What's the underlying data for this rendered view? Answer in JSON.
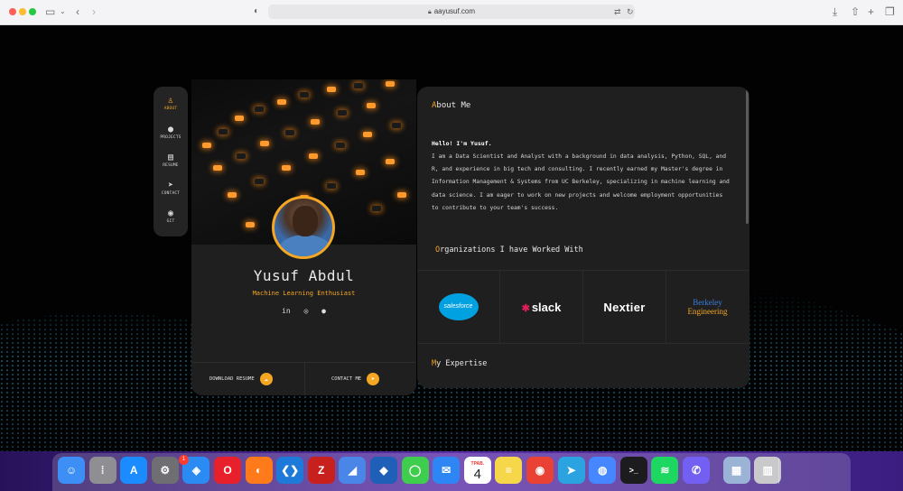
{
  "browser": {
    "url": "aayusuf.com",
    "icons": {
      "sidebar": "sidebar-icon",
      "back": "chevron-left-icon",
      "forward": "chevron-right-icon",
      "shield": "shield-icon",
      "translate": "translate-icon",
      "reload": "reload-icon",
      "download": "download-icon",
      "share": "share-icon",
      "new_tab": "plus-icon",
      "tabs": "tabs-icon"
    }
  },
  "nav": {
    "items": [
      {
        "label": "ABOUT",
        "icon": "user-icon",
        "glyph": "♙",
        "active": true
      },
      {
        "label": "PROJECTS",
        "icon": "lightbulb-icon",
        "glyph": "●",
        "active": false
      },
      {
        "label": "RESUME",
        "icon": "document-icon",
        "glyph": "▤",
        "active": false
      },
      {
        "label": "CONTACT",
        "icon": "paper-plane-icon",
        "glyph": "➤",
        "active": false
      },
      {
        "label": "GIT",
        "icon": "github-icon",
        "glyph": "◉",
        "active": false
      }
    ]
  },
  "profile": {
    "name": "Yusuf Abdul",
    "subtitle": "Machine Learning Enthusiast",
    "socials": [
      {
        "icon": "linkedin-icon",
        "glyph": "in"
      },
      {
        "icon": "instagram-icon",
        "glyph": "◎"
      },
      {
        "icon": "github-icon",
        "glyph": "●"
      }
    ],
    "download_label": "DOWNLOAD RESUME",
    "contact_label": "CONTACT ME"
  },
  "about": {
    "title_first": "A",
    "title_rest": "bout Me",
    "hello": "Hello! I'm Yusuf.",
    "text": "I am a Data Scientist and Analyst with a background in data analysis, Python, SQL, and R, and experience in big tech and consulting. I recently earned my Master's degree in Information Management & Systems from UC Berkeley, specializing in machine learning and data science. I am eager to work on new projects and welcome employment opportunities to contribute to your team's success.",
    "orgs_title_first": "O",
    "orgs_title_rest": "rganizations I have Worked With",
    "orgs": [
      {
        "name": "salesforce",
        "icon": "salesforce-logo-icon"
      },
      {
        "name": "slack",
        "icon": "slack-logo-icon"
      },
      {
        "name": "Nextier",
        "icon": "nextier-logo-icon"
      },
      {
        "name_line1": "Berkeley",
        "name_line2": "Engineering",
        "icon": "berkeley-logo-icon"
      }
    ],
    "expertise_title_first": "M",
    "expertise_title_rest": "y Expertise"
  },
  "dock": {
    "finder_badge": "1",
    "calendar_month": "ТРАВ.",
    "calendar_day": "4",
    "apps": [
      {
        "name": "finder-icon",
        "color": "#3d8ff5",
        "glyph": "☺"
      },
      {
        "name": "launchpad-icon",
        "color": "#8e8e93",
        "glyph": "⁞"
      },
      {
        "name": "app-store-icon",
        "color": "#1a8cff",
        "glyph": "A"
      },
      {
        "name": "system-settings-icon",
        "color": "#6e6e73",
        "glyph": "⚙"
      },
      {
        "name": "safari-icon",
        "color": "#2b8bf2",
        "glyph": "◈"
      },
      {
        "name": "opera-icon",
        "color": "#e8202b",
        "glyph": "O"
      },
      {
        "name": "firefox-icon",
        "color": "#ff7a1a",
        "glyph": "◐"
      },
      {
        "name": "vscode-icon",
        "color": "#1e7ad8",
        "glyph": "❮❯"
      },
      {
        "name": "filezilla-icon",
        "color": "#c8201c",
        "glyph": "Z"
      },
      {
        "name": "screenium-icon",
        "color": "#4a86e8",
        "glyph": "◢"
      },
      {
        "name": "outline-icon",
        "color": "#1f5fb8",
        "glyph": "◆"
      },
      {
        "name": "messages-icon",
        "color": "#3fcd4d",
        "glyph": "◯"
      },
      {
        "name": "mail-icon",
        "color": "#2e86f5",
        "glyph": "✉"
      },
      {
        "name": "calendar-icon",
        "color": "#ffffff",
        "glyph": ""
      },
      {
        "name": "notes-icon",
        "color": "#f7d74a",
        "glyph": "≡"
      },
      {
        "name": "chrome-icon",
        "color": "#e94235",
        "glyph": "◉"
      },
      {
        "name": "telegram-icon",
        "color": "#2aa3e0",
        "glyph": "➤"
      },
      {
        "name": "nordvpn-icon",
        "color": "#4687ff",
        "glyph": "◍"
      },
      {
        "name": "terminal-icon",
        "color": "#1c1c1e",
        "glyph": ">_"
      },
      {
        "name": "spotify-icon",
        "color": "#1ed760",
        "glyph": "≋"
      },
      {
        "name": "viber-icon",
        "color": "#7360f2",
        "glyph": "✆"
      },
      {
        "name": "preview-icon",
        "color": "#9bb4d6",
        "glyph": "▦"
      },
      {
        "name": "trash-icon",
        "color": "#c9c9cc",
        "glyph": "▥"
      }
    ]
  }
}
